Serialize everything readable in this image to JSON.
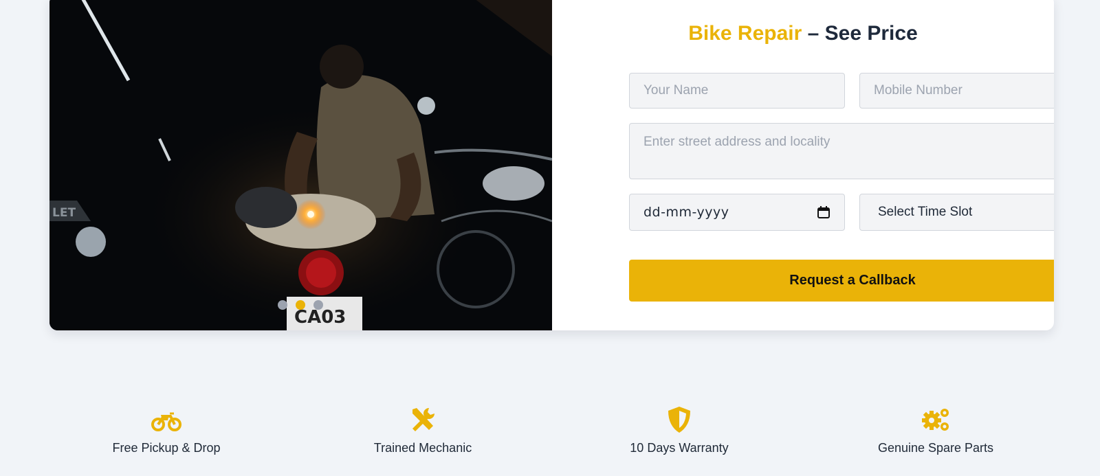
{
  "form": {
    "title_accent": "Bike Repair",
    "title_rest": " – See Price",
    "name_placeholder": "Your Name",
    "mobile_placeholder": "Mobile Number",
    "address_placeholder": "Enter street address and locality",
    "date_value": "dd-mm-yyyy",
    "time_slot_value": "Select Time Slot",
    "submit_label": "Request a Callback"
  },
  "slider": {
    "dots": 3,
    "active_index": 1
  },
  "features": [
    {
      "icon": "motorcycle-icon",
      "label": "Free Pickup & Drop"
    },
    {
      "icon": "tools-icon",
      "label": "Trained Mechanic"
    },
    {
      "icon": "shield-icon",
      "label": "10 Days Warranty"
    },
    {
      "icon": "gears-icon",
      "label": "Genuine Spare Parts"
    }
  ],
  "colors": {
    "accent": "#eab308",
    "heading": "#1e293b",
    "page_bg": "#f1f4f8"
  }
}
